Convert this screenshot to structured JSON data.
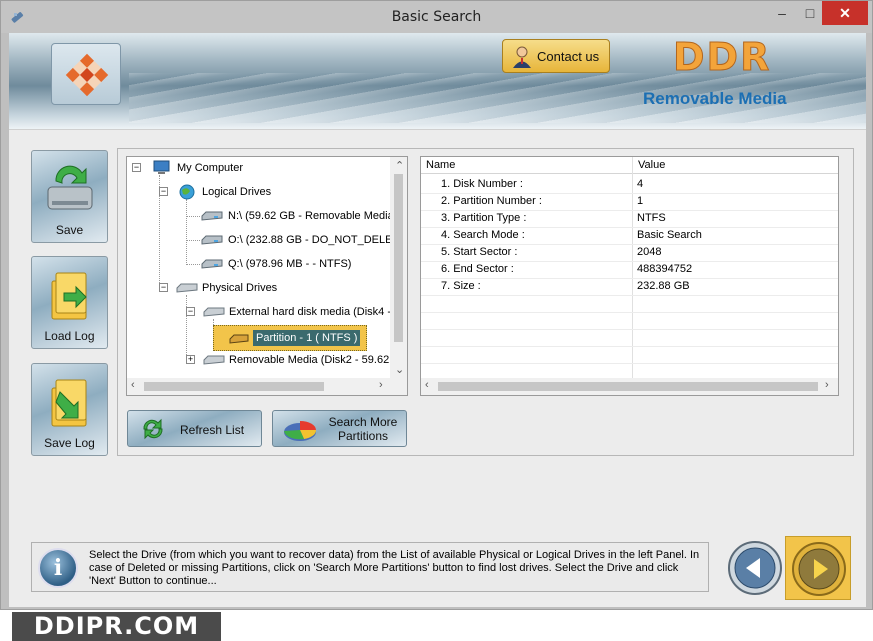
{
  "window": {
    "title": "Basic Search",
    "min_glyph": "–",
    "max_glyph": "□",
    "close_glyph": "✕"
  },
  "header": {
    "contact_label": "Contact us",
    "brand": "DDR",
    "subbrand": "Removable Media"
  },
  "sidebar": {
    "save_label": "Save",
    "load_log_label": "Load Log",
    "save_log_label": "Save Log"
  },
  "tree": {
    "root": "My Computer",
    "logical": "Logical Drives",
    "drive_n": "N:\\ (59.62 GB - Removable Media",
    "drive_o": "O:\\ (232.88 GB - DO_NOT_DELE",
    "drive_q": "Q:\\ (978.96 MB -  - NTFS)",
    "physical": "Physical Drives",
    "disk4": "External hard disk media (Disk4 -",
    "partition": "Partition - 1 ( NTFS )",
    "disk2": "Removable Media (Disk2 - 59.62"
  },
  "table": {
    "headers": [
      "Name",
      "Value"
    ],
    "rows": [
      {
        "name": "1. Disk Number :",
        "value": "4"
      },
      {
        "name": "2. Partition Number :",
        "value": "1"
      },
      {
        "name": "3. Partition Type :",
        "value": "NTFS"
      },
      {
        "name": "4. Search Mode :",
        "value": "Basic Search"
      },
      {
        "name": "5. Start Sector :",
        "value": "2048"
      },
      {
        "name": "6. End Sector :",
        "value": "488394752"
      },
      {
        "name": "7. Size :",
        "value": "232.88 GB"
      }
    ]
  },
  "actions": {
    "refresh": "Refresh List",
    "search_more_1": "Search More",
    "search_more_2": "Partitions"
  },
  "info": {
    "text": "Select the Drive (from which you want to recover data) from the List of available Physical or Logical Drives in the left Panel. In case of Deleted or missing Partitions, click on 'Search More Partitions' button to find lost drives. Select the Drive and click 'Next' Button to continue..."
  },
  "footer": {
    "logo": "DDIPR.COM"
  },
  "colors": {
    "selected_bg": "#f2c44a",
    "close_red": "#c7312a",
    "brand_orange": "#f3a43a",
    "brand_blue": "#1c6fb3"
  }
}
